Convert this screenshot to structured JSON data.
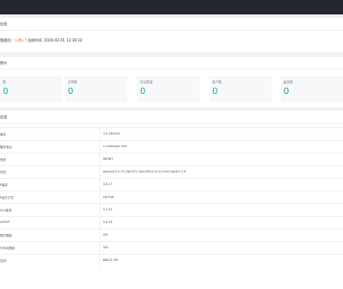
{
  "welcome": {
    "title": "信息",
    "prefix": "管理员：",
    "user": "luffy",
    "time_label": "当前时间:",
    "time": "2020-02-01 13:39:32"
  },
  "stats": {
    "title": "统计",
    "items": [
      {
        "label": "数",
        "value": "0"
      },
      {
        "label": "文章数",
        "value": "0"
      },
      {
        "label": "评论数量",
        "value": "0"
      },
      {
        "label": "用户数",
        "value": "0"
      },
      {
        "label": "留言数",
        "value": "0"
      }
    ]
  },
  "sys": {
    "title": "信息",
    "rows": [
      {
        "k": "版本",
        "v": "1.0.180420"
      },
      {
        "k": "服务地址",
        "v": "x.xuebingsi.com"
      },
      {
        "k": "系统",
        "v": "WINNT"
      },
      {
        "k": "环境",
        "v": "Apache/2.4.23 (Win32) OpenSSL/1.0.2j mod_fcgid/2.3.9"
      },
      {
        "k": "P版本",
        "v": "5.6.27"
      },
      {
        "k": "P运行方式",
        "v": "cgi-fcgi"
      },
      {
        "k": "SQL版本",
        "v": "5.5.53"
      },
      {
        "k": "nkPHP",
        "v": "5.0.19"
      },
      {
        "k": "附件限制",
        "v": "2M"
      },
      {
        "k": "行时间限制",
        "v": "30s"
      },
      {
        "k": "空间",
        "v": "86015.2M"
      }
    ]
  }
}
